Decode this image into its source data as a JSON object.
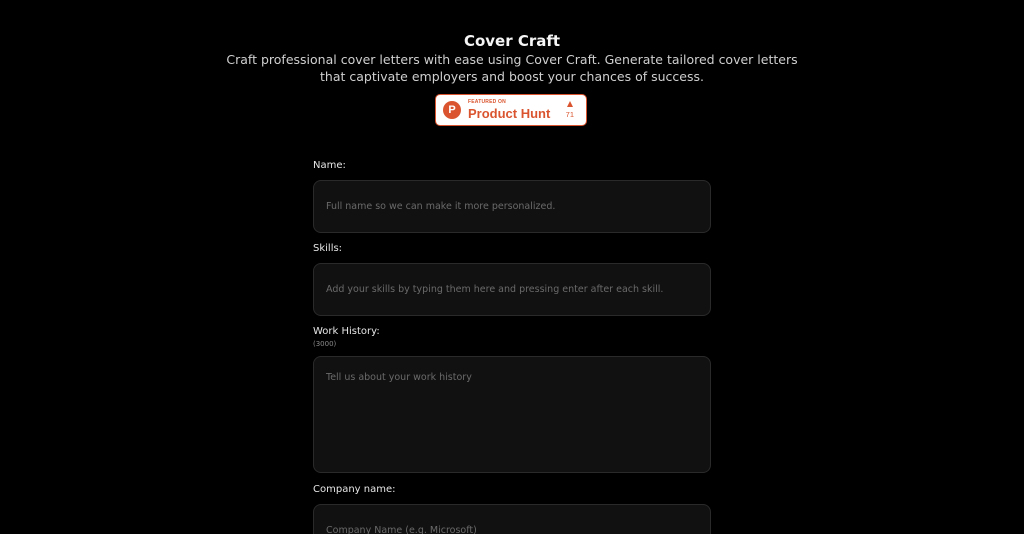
{
  "header": {
    "title": "Cover Craft",
    "subtitle": "Craft professional cover letters with ease using Cover Craft. Generate tailored cover letters that captivate employers and boost your chances of success."
  },
  "product_hunt": {
    "logo_letter": "P",
    "featured_label": "FEATURED ON",
    "name": "Product Hunt",
    "votes": "71",
    "accent_color": "#da552f"
  },
  "form": {
    "name": {
      "label": "Name:",
      "placeholder": "Full name so we can make it more personalized."
    },
    "skills": {
      "label": "Skills:",
      "placeholder": "Add your skills by typing them here and pressing enter after each skill."
    },
    "work_history": {
      "label": "Work History:",
      "char_limit": "(3000)",
      "placeholder": "Tell us about your work history"
    },
    "company_name": {
      "label": "Company name:",
      "placeholder": "Company Name (e.g. Microsoft)"
    }
  }
}
